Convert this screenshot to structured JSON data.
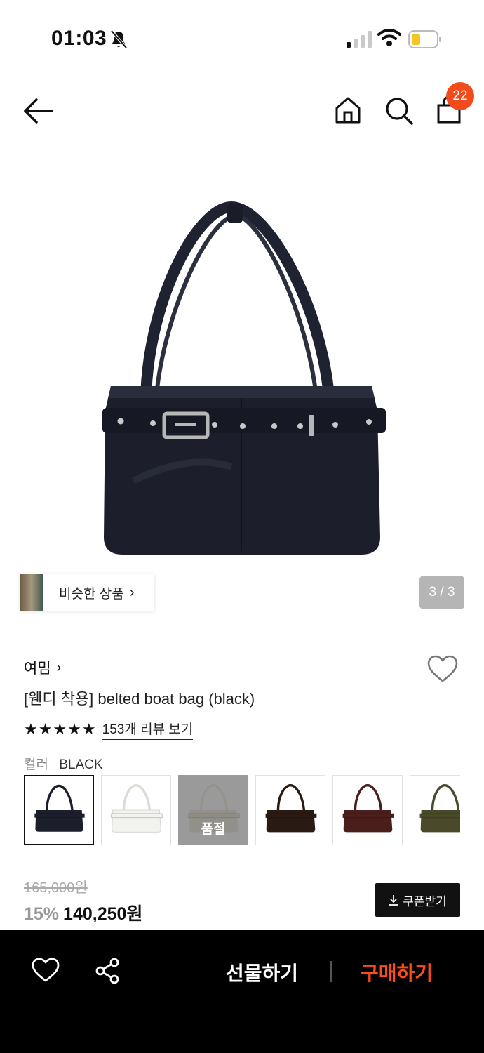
{
  "status_bar": {
    "time": "01:03",
    "icons": [
      "bell-slash-icon",
      "signal-icon",
      "wifi-icon",
      "battery-icon"
    ]
  },
  "nav": {
    "icons": [
      "back-arrow-icon",
      "home-icon",
      "search-icon",
      "shopping-bag-icon"
    ],
    "cart_count": "22"
  },
  "gallery": {
    "similar_label": "비슷한 상품",
    "pager": "3 / 3"
  },
  "product": {
    "brand": "여밈",
    "title": "[웬디 착용] belted boat bag (black)",
    "stars": "★★★★★",
    "rating_stars": 5,
    "review_link": "153개 리뷰 보기",
    "color_label": "컬러",
    "color_value": "BLACK",
    "swatches": [
      {
        "color": "#1c1f2b",
        "selected": true
      },
      {
        "color": "#f2f2ee",
        "selected": false
      },
      {
        "color": "#8e8a80",
        "soldout": true,
        "label": "품절"
      },
      {
        "color": "#2a1a14",
        "selected": false
      },
      {
        "color": "#4a1e1a",
        "selected": false
      },
      {
        "color": "#4a4a2a",
        "selected": false
      }
    ],
    "original_price": "165,000원",
    "discount": "15%",
    "price": "140,250원",
    "coupon_label": "쿠폰받기"
  },
  "bottom_bar": {
    "gift_label": "선물하기",
    "buy_label": "구매하기"
  },
  "colors": {
    "accent": "#ff4a1a",
    "badge": "#f24b1b",
    "text": "#111111"
  }
}
